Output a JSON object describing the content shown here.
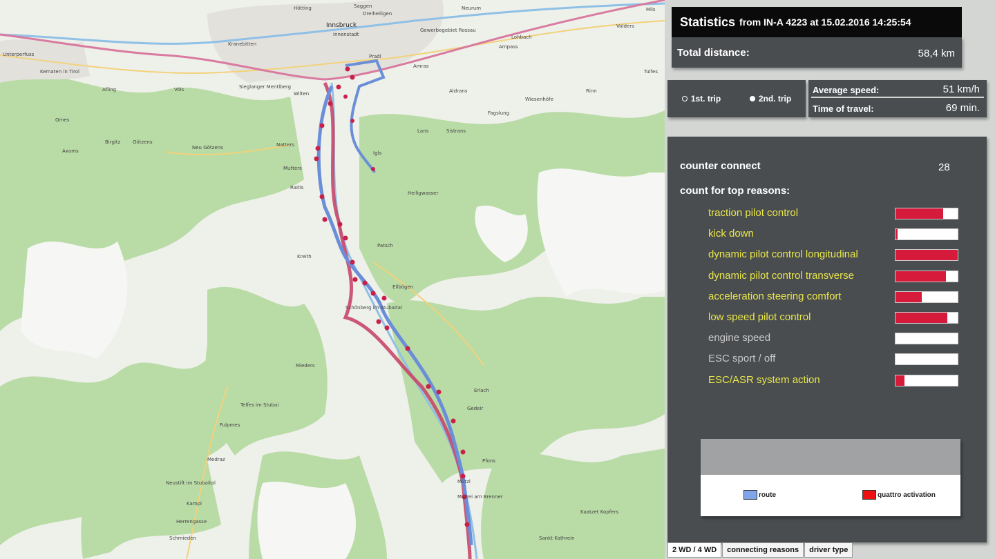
{
  "map": {
    "places": [
      {
        "id": "hotting",
        "label": "Hötting",
        "big": false
      },
      {
        "id": "innsbruck",
        "label": "Innsbruck",
        "big": true
      },
      {
        "id": "innenstadt",
        "label": "Innenstadt",
        "big": false
      },
      {
        "id": "saggen",
        "label": "Saggen",
        "big": false
      },
      {
        "id": "dreiheiligen",
        "label": "Dreiheiligen",
        "big": false
      },
      {
        "id": "neurum",
        "label": "Neurum",
        "big": false
      },
      {
        "id": "gewerbegebiet",
        "label": "Gewerbegebiet Rossau",
        "big": false
      },
      {
        "id": "kranebitten",
        "label": "Kranebitten",
        "big": false
      },
      {
        "id": "unterperfuss",
        "label": "Unterperfuss",
        "big": false
      },
      {
        "id": "kematen",
        "label": "Kematen in Tirol",
        "big": false
      },
      {
        "id": "afling",
        "label": "Afling",
        "big": false
      },
      {
        "id": "volls",
        "label": "Völs",
        "big": false
      },
      {
        "id": "siegl",
        "label": "Sieglanger Mentlberg",
        "big": false
      },
      {
        "id": "wilten",
        "label": "Wilten",
        "big": false
      },
      {
        "id": "pradl",
        "label": "Pradl",
        "big": false
      },
      {
        "id": "amras",
        "label": "Amras",
        "big": false
      },
      {
        "id": "ampass",
        "label": "Ampass",
        "big": false
      },
      {
        "id": "aldrans",
        "label": "Aldrans",
        "big": false
      },
      {
        "id": "lans",
        "label": "Lans",
        "big": false
      },
      {
        "id": "sistrans",
        "label": "Sistrans",
        "big": false
      },
      {
        "id": "igls",
        "label": "Igls",
        "big": false
      },
      {
        "id": "natters",
        "label": "Natters",
        "big": false
      },
      {
        "id": "mutters",
        "label": "Mutters",
        "big": false
      },
      {
        "id": "raitis",
        "label": "Raitis",
        "big": false
      },
      {
        "id": "omes",
        "label": "Omes",
        "big": false
      },
      {
        "id": "birgitz",
        "label": "Birgitz",
        "big": false
      },
      {
        "id": "gotzens",
        "label": "Götzens",
        "big": false
      },
      {
        "id": "axams",
        "label": "Axams",
        "big": false
      },
      {
        "id": "neugotzens",
        "label": "Neu Götzens",
        "big": false
      },
      {
        "id": "patsch",
        "label": "Patsch",
        "big": false
      },
      {
        "id": "heiligwasser",
        "label": "Heiligwasser",
        "big": false
      },
      {
        "id": "ellbogen",
        "label": "Ellbögen",
        "big": false
      },
      {
        "id": "schonberg",
        "label": "Schönberg im Stubaital",
        "big": false
      },
      {
        "id": "mieders",
        "label": "Mieders",
        "big": false
      },
      {
        "id": "telfes",
        "label": "Telfes im Stubai",
        "big": false
      },
      {
        "id": "fulpmes",
        "label": "Fulpmes",
        "big": false
      },
      {
        "id": "medraz",
        "label": "Medraz",
        "big": false
      },
      {
        "id": "neustift",
        "label": "Neustift im Stubaital",
        "big": false
      },
      {
        "id": "schmieden",
        "label": "Schmieden",
        "big": false
      },
      {
        "id": "herrengasse",
        "label": "Herrengasse",
        "big": false
      },
      {
        "id": "kampl",
        "label": "Kampl",
        "big": false
      },
      {
        "id": "mutz",
        "label": "Mützl",
        "big": false
      },
      {
        "id": "matrei",
        "label": "Matrei am Brenner",
        "big": false
      },
      {
        "id": "pfons",
        "label": "Pfons",
        "big": false
      },
      {
        "id": "gedeir",
        "label": "Gedeir",
        "big": false
      },
      {
        "id": "erlach",
        "label": "Erlach",
        "big": false
      },
      {
        "id": "sanktkathrein",
        "label": "Sankt Kathrein",
        "big": false
      },
      {
        "id": "kaatzet",
        "label": "Kaatzet Kopfers",
        "big": false
      },
      {
        "id": "tulfes",
        "label": "Tulfes",
        "big": false
      },
      {
        "id": "rinn",
        "label": "Rinn",
        "big": false
      },
      {
        "id": "fagslung",
        "label": "Fagslung",
        "big": false
      },
      {
        "id": "wiesenhofe",
        "label": "Wiesenhöfe",
        "big": false
      },
      {
        "id": "lohbach",
        "label": "Lohbach",
        "big": false
      },
      {
        "id": "kreith",
        "label": "Kreith",
        "big": false
      },
      {
        "id": "mils",
        "label": "Mils",
        "big": false
      },
      {
        "id": "volders",
        "label": "Volders",
        "big": false
      }
    ]
  },
  "stats": {
    "title_main": "Statistics",
    "title_sub": "from IN-A 4223 at 15.02.2016 14:25:54",
    "total_distance_label": "Total distance:",
    "total_distance_value": "58,4 km"
  },
  "trips": {
    "first_label": "1st. trip",
    "second_label": "2nd. trip",
    "selected": "second"
  },
  "speed": {
    "avg_label": "Average speed:",
    "avg_value": "51 km/h",
    "time_label": "Time of travel:",
    "time_value": "69 min."
  },
  "reasons": {
    "counter_label": "counter connect",
    "counter_value": "28",
    "top_label": "count for top reasons:",
    "items": [
      {
        "name": "traction pilot control",
        "fraction": 0.77,
        "color": "#e8e64a"
      },
      {
        "name": "kick down",
        "fraction": 0.03,
        "color": "#e8e64a"
      },
      {
        "name": "dynamic pilot control longitudinal",
        "fraction": 1.0,
        "color": "#e8e64a"
      },
      {
        "name": "dynamic pilot control transverse",
        "fraction": 0.81,
        "color": "#e8e64a"
      },
      {
        "name": "acceleration steering comfort",
        "fraction": 0.42,
        "color": "#e8e64a"
      },
      {
        "name": "low speed pilot control",
        "fraction": 0.83,
        "color": "#e8e64a"
      },
      {
        "name": "engine speed",
        "fraction": 0.0,
        "color": "#c8c8c8"
      },
      {
        "name": "ESC sport / off",
        "fraction": 0.0,
        "color": "#c8c8c8"
      },
      {
        "name": "ESC/ASR system action",
        "fraction": 0.14,
        "color": "#e8e64a"
      }
    ]
  },
  "legend": {
    "route_label": "route",
    "route_color": "#7fa6e8",
    "quattro_label": "quattro activation",
    "quattro_color": "#ee1111"
  },
  "tabs": [
    {
      "label": "2 WD / 4 WD",
      "active": true
    },
    {
      "label": "connecting reasons",
      "active": false
    },
    {
      "label": "driver type",
      "active": false
    }
  ],
  "colors": {
    "red_route": "#c8476a",
    "blue_route": "#6a8ed8",
    "forest": "#b9dba6",
    "bar_fill": "#d61a3c"
  }
}
